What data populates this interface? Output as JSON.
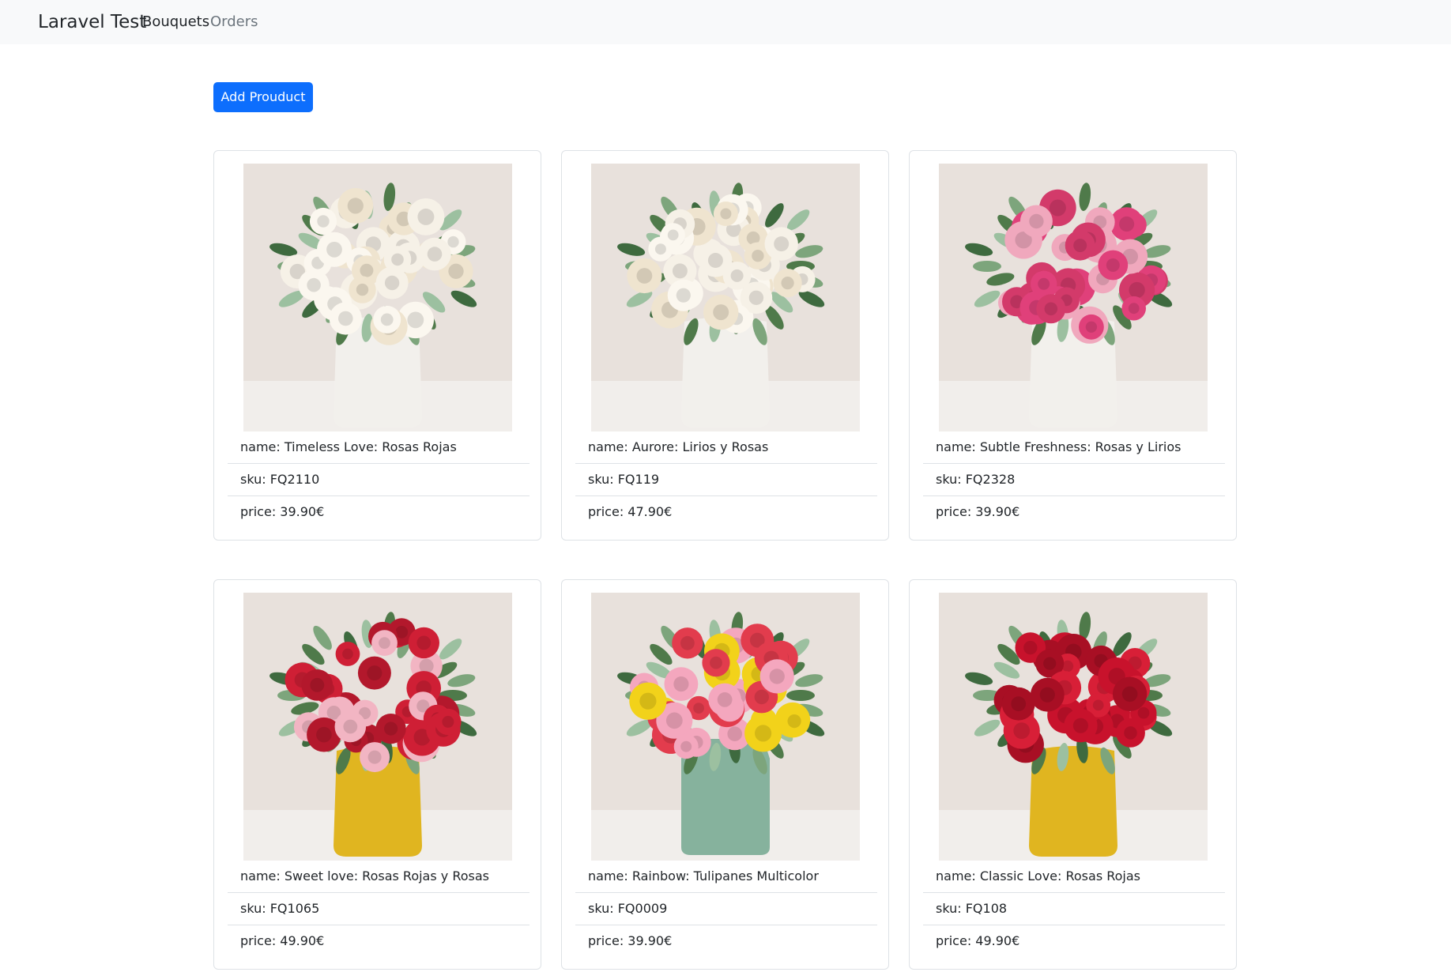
{
  "navbar": {
    "brand": "Laravel Test",
    "links": [
      {
        "label": "Bouquets",
        "active": true
      },
      {
        "label": "Orders",
        "active": false
      }
    ]
  },
  "toolbar": {
    "add_label": "Add Prouduct"
  },
  "products": [
    {
      "name": "name: Timeless Love: Rosas Rojas",
      "sku": "sku: FQ2110",
      "price": "price: 39.90€",
      "vase_color": "#f2f0ec",
      "flowers": [
        "#f6f1e7",
        "#fbf7ef",
        "#efe4cf"
      ]
    },
    {
      "name": "name: Aurore: Lirios y Rosas",
      "sku": "sku: FQ119",
      "price": "price: 47.90€",
      "vase_color": "#f2f0ec",
      "flowers": [
        "#f6f1e7",
        "#fbf7ef",
        "#efe4cf"
      ]
    },
    {
      "name": "name: Subtle Freshness: Rosas y Lirios",
      "sku": "sku: FQ2328",
      "price": "price: 39.90€",
      "vase_color": "#f2f0ec",
      "flowers": [
        "#e0407a",
        "#f0a8bd",
        "#d33a6a"
      ]
    },
    {
      "name": "name: Sweet love: Rosas Rojas y Rosas",
      "sku": "sku: FQ1065",
      "price": "price: 49.90€",
      "vase_color": "#e0b520",
      "flowers": [
        "#cf1f35",
        "#f2b5c3",
        "#b3182c"
      ]
    },
    {
      "name": "name: Rainbow: Tulipanes Multicolor",
      "sku": "sku: FQ0009",
      "price": "price: 39.90€",
      "vase_color": "#86b29d",
      "flowers": [
        "#f2d21a",
        "#e23c4d",
        "#f4a7be"
      ]
    },
    {
      "name": "name: Classic Love: Rosas Rojas",
      "sku": "sku: FQ108",
      "price": "price: 49.90€",
      "vase_color": "#e0b520",
      "flowers": [
        "#c8122c",
        "#d81f37",
        "#a80f24"
      ]
    }
  ]
}
